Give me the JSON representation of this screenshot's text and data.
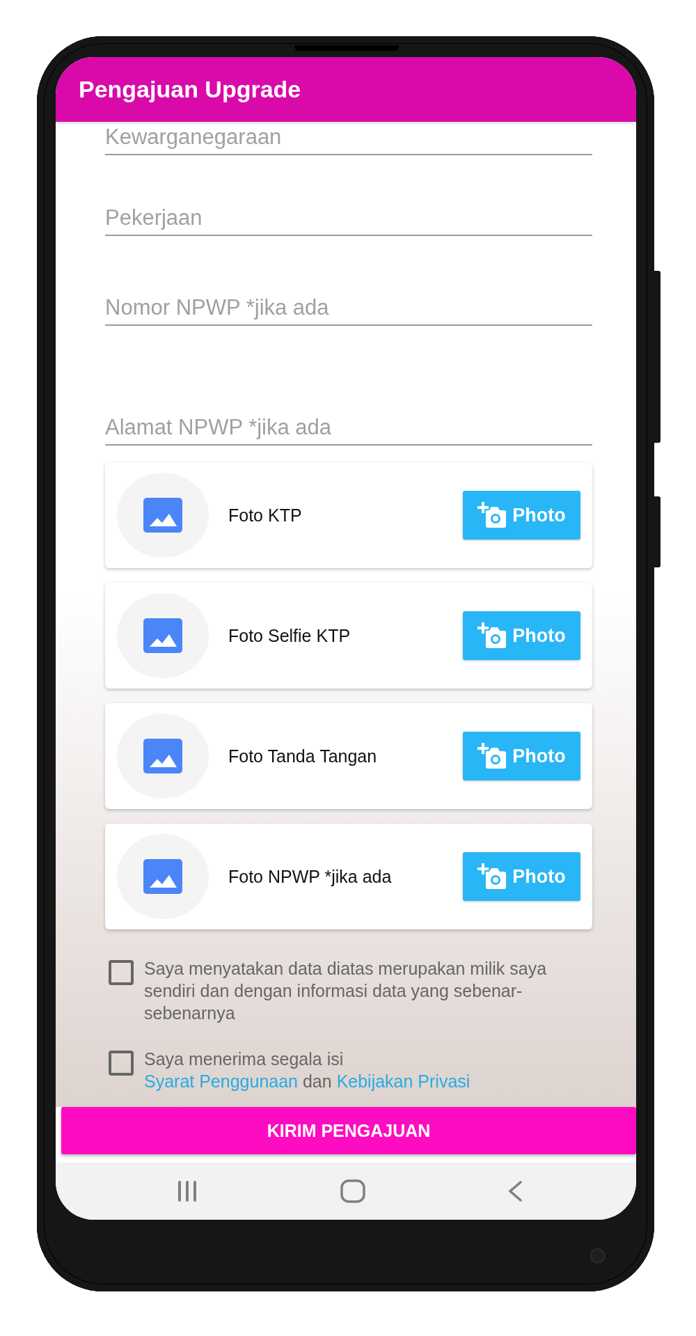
{
  "app_bar": {
    "title": "Pengajuan Upgrade"
  },
  "fields": [
    {
      "placeholder": "Kewarganegaraan"
    },
    {
      "placeholder": "Pekerjaan"
    },
    {
      "placeholder": "Nomor NPWP *jika ada"
    },
    {
      "placeholder": "Alamat NPWP *jika ada"
    }
  ],
  "photo_uploads": [
    {
      "label": "Foto KTP",
      "button": "Photo"
    },
    {
      "label": "Foto Selfie KTP",
      "button": "Photo"
    },
    {
      "label": "Foto Tanda Tangan",
      "button": "Photo"
    },
    {
      "label": "Foto NPWP *jika ada",
      "button": "Photo"
    }
  ],
  "agreements": [
    {
      "kind": "plain",
      "checked": false,
      "text": "Saya menyatakan data diatas merupakan milik saya sendiri dan dengan informasi data yang sebenar-sebenarnya"
    },
    {
      "kind": "links",
      "checked": false,
      "text": "Saya menerima segala isi",
      "link_1": "Syarat Penggunaan",
      "connector": "dan",
      "link_2": "Kebijakan Privasi"
    }
  ],
  "submit_button": "KIRIM PENGAJUAN"
}
